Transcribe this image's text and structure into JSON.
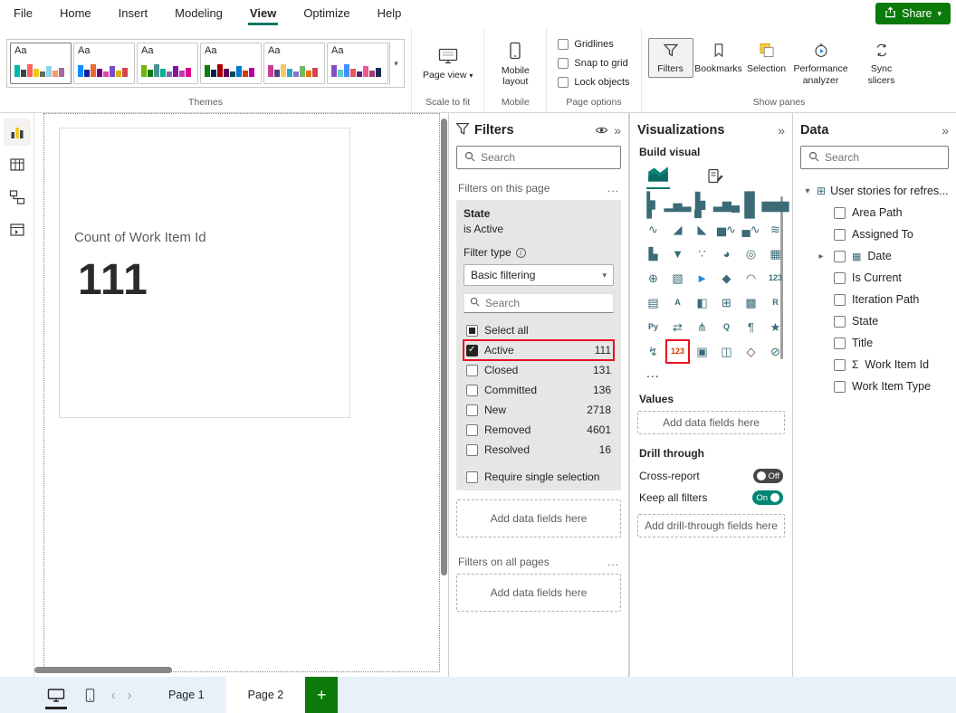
{
  "app": {
    "menu": [
      "File",
      "Home",
      "Insert",
      "Modeling",
      "View",
      "Optimize",
      "Help"
    ],
    "active_menu": "View",
    "share_label": "Share"
  },
  "ribbon": {
    "themes_label": "Themes",
    "theme_palettes": [
      [
        "#01B8AA",
        "#374649",
        "#FD625E",
        "#F2C80F",
        "#5F6B6D",
        "#8AD4EB",
        "#FE9666",
        "#A66999"
      ],
      [
        "#118DFF",
        "#12239E",
        "#E66C37",
        "#6B007B",
        "#E044A7",
        "#744EC2",
        "#D9B300",
        "#D64550"
      ],
      [
        "#70B603",
        "#107C10",
        "#499195",
        "#00B294",
        "#8764B8",
        "#881798",
        "#C239B3",
        "#E3008C"
      ],
      [
        "#107C10",
        "#002050",
        "#A80000",
        "#5C005C",
        "#004B50",
        "#0078D4",
        "#D83B01",
        "#B4009E"
      ],
      [
        "#C83D95",
        "#4B4279",
        "#F5C869",
        "#2CA8C2",
        "#8D6FD1",
        "#73B761",
        "#E87200",
        "#D64550"
      ],
      [
        "#8250C4",
        "#5ECBC8",
        "#438FFF",
        "#EB5757",
        "#5B2071",
        "#EC5A96",
        "#A43B76",
        "#182C55"
      ]
    ],
    "page_view_label": "Page view",
    "scale_to_fit_label": "Scale to fit",
    "mobile_layout_label": "Mobile layout",
    "mobile_group_label": "Mobile",
    "page_options_label": "Page options",
    "page_options": [
      "Gridlines",
      "Snap to grid",
      "Lock objects"
    ],
    "show_panes_label": "Show panes",
    "show_panes": [
      {
        "label": "Filters",
        "icon": "filter-icon",
        "selected": true
      },
      {
        "label": "Bookmarks",
        "icon": "bookmark-icon",
        "selected": false
      },
      {
        "label": "Selection",
        "icon": "selection-icon",
        "selected": false
      },
      {
        "label": "Performance analyzer",
        "icon": "performance-icon",
        "selected": false
      },
      {
        "label": "Sync slicers",
        "icon": "sync-icon",
        "selected": false
      }
    ]
  },
  "canvas": {
    "card_title": "Count of Work Item Id",
    "card_value": "111"
  },
  "filters_pane": {
    "title": "Filters",
    "search_placeholder": "Search",
    "section_page_label": "Filters on this page",
    "section_all_label": "Filters on all pages",
    "more_label": "...",
    "card": {
      "field": "State",
      "condition": "is Active",
      "filter_type_label": "Filter type",
      "filter_type_value": "Basic filtering",
      "search_placeholder": "Search",
      "options": [
        {
          "label": "Select all",
          "count": "",
          "state": "partial",
          "highlight": false
        },
        {
          "label": "Active",
          "count": "111",
          "state": "checked",
          "highlight": true
        },
        {
          "label": "Closed",
          "count": "131",
          "state": "unchecked",
          "highlight": false
        },
        {
          "label": "Committed",
          "count": "136",
          "state": "unchecked",
          "highlight": false
        },
        {
          "label": "New",
          "count": "2718",
          "state": "unchecked",
          "highlight": false
        },
        {
          "label": "Removed",
          "count": "4601",
          "state": "unchecked",
          "highlight": false
        },
        {
          "label": "Resolved",
          "count": "16",
          "state": "unchecked",
          "highlight": false
        }
      ],
      "require_single_label": "Require single selection"
    },
    "add_fields_placeholder": "Add data fields here"
  },
  "viz_pane": {
    "title": "Visualizations",
    "build_label": "Build visual",
    "more_label": "...",
    "icons": [
      {
        "name": "stacked-bar-chart",
        "g": "▂▅▃",
        "r": 1
      },
      {
        "name": "stacked-column-chart",
        "g": "▂▅▃"
      },
      {
        "name": "clustered-bar-chart",
        "g": "▃▆▄",
        "r": 1
      },
      {
        "name": "clustered-column-chart",
        "g": "▃▆▄"
      },
      {
        "name": "100-stacked-bar-chart",
        "g": "▆▆▆",
        "r": 1
      },
      {
        "name": "100-stacked-column-chart",
        "g": "▆▆▆"
      },
      {
        "name": "line-chart",
        "g": "∿"
      },
      {
        "name": "area-chart",
        "g": "◢"
      },
      {
        "name": "stacked-area-chart",
        "g": "◣"
      },
      {
        "name": "line-and-stacked-column-chart",
        "g": "▅∿"
      },
      {
        "name": "line-and-clustered-column-chart",
        "g": "▄∿"
      },
      {
        "name": "ribbon-chart",
        "g": "≋"
      },
      {
        "name": "waterfall-chart",
        "g": "▙"
      },
      {
        "name": "funnel-chart",
        "g": "▼"
      },
      {
        "name": "scatter-chart",
        "g": "∵"
      },
      {
        "name": "pie-chart",
        "g": "◕"
      },
      {
        "name": "donut-chart",
        "g": "◎"
      },
      {
        "name": "treemap",
        "g": "▦"
      },
      {
        "name": "map",
        "g": "⊕"
      },
      {
        "name": "filled-map",
        "g": "▧"
      },
      {
        "name": "azure-map",
        "g": "►",
        "c": "#2B88D8"
      },
      {
        "name": "shape-map",
        "g": "◆"
      },
      {
        "name": "gauge",
        "g": "◠"
      },
      {
        "name": "card",
        "g": "123",
        "t": 1
      },
      {
        "name": "multi-row-card",
        "g": "▤"
      },
      {
        "name": "kpi",
        "g": "A",
        "t": 1
      },
      {
        "name": "slicer",
        "g": "◧"
      },
      {
        "name": "table",
        "g": "⊞"
      },
      {
        "name": "matrix",
        "g": "▩"
      },
      {
        "name": "r-script-visual",
        "g": "R",
        "t": 1
      },
      {
        "name": "python-visual",
        "g": "Py",
        "t": 1
      },
      {
        "name": "key-influencers",
        "g": "⇄"
      },
      {
        "name": "decomposition-tree",
        "g": "⋔"
      },
      {
        "name": "qa-visual",
        "g": "Q",
        "t": 1
      },
      {
        "name": "smart-narrative",
        "g": "¶"
      },
      {
        "name": "metrics",
        "g": "★"
      },
      {
        "name": "power-automate",
        "g": "↯"
      },
      {
        "name": "card-new",
        "g": "123",
        "t": 1,
        "hl": 1,
        "c": "#D83B01"
      },
      {
        "name": "button-slicer",
        "g": "▣"
      },
      {
        "name": "text-slicer",
        "g": "◫"
      },
      {
        "name": "power-apps",
        "g": "◇",
        "c": "#742774"
      },
      {
        "name": "arcgis-map",
        "g": "⊘"
      }
    ],
    "values_label": "Values",
    "values_placeholder": "Add data fields here",
    "drill_label": "Drill through",
    "cross_report_label": "Cross-report",
    "cross_report_state": "Off",
    "keep_filters_label": "Keep all filters",
    "keep_filters_state": "On",
    "drill_placeholder": "Add drill-through fields here"
  },
  "data_pane": {
    "title": "Data",
    "search_placeholder": "Search",
    "table_label": "User stories for refres...",
    "fields": [
      {
        "label": "Area Path"
      },
      {
        "label": "Assigned To"
      },
      {
        "label": "Date",
        "expandable": true,
        "icon": "calendar"
      },
      {
        "label": "Is Current"
      },
      {
        "label": "Iteration Path"
      },
      {
        "label": "State"
      },
      {
        "label": "Title"
      },
      {
        "label": "Work Item Id",
        "icon": "sigma"
      },
      {
        "label": "Work Item Type"
      }
    ]
  },
  "footer": {
    "page1_label": "Page 1",
    "page2_label": "Page 2",
    "add_page_label": "+"
  },
  "colors": {
    "highlight_red": "#E81123",
    "accent_green": "#0B7A0B",
    "toggle_on": "#018574",
    "active_underline": "#117865"
  }
}
